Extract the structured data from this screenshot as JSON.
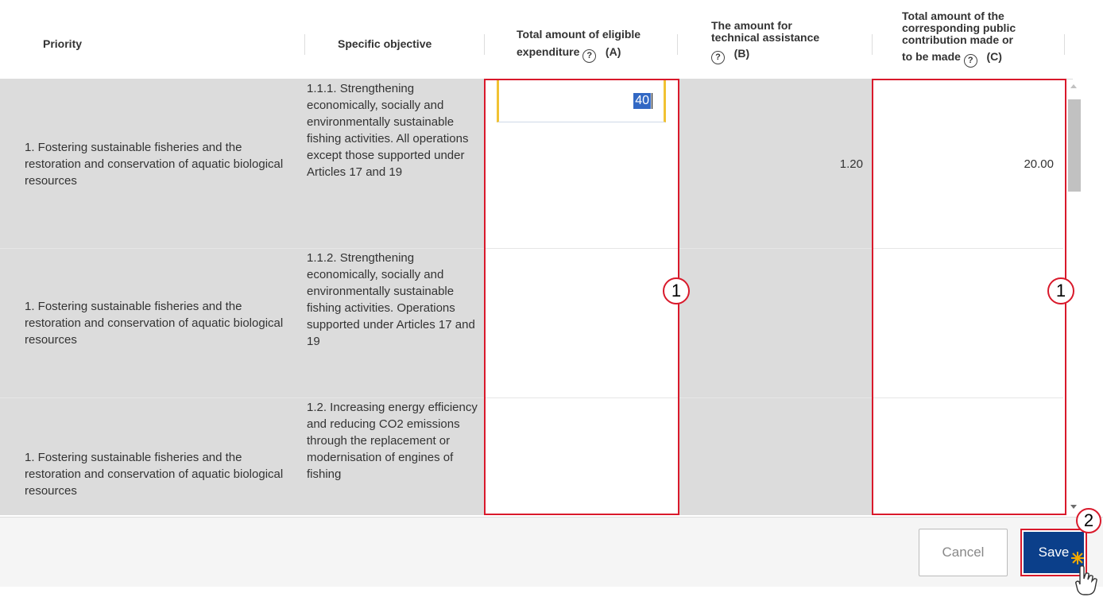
{
  "header": {
    "priority": "Priority",
    "specific_objective": "Specific objective",
    "col_a_line1": "Total amount of eligible",
    "col_a_line2": "expenditure",
    "col_a_tag": "(A)",
    "col_b_line1": "The amount for",
    "col_b_line2": "technical assistance",
    "col_b_tag": "(B)",
    "col_c_line1": "Total amount of the",
    "col_c_line2": "corresponding public",
    "col_c_line3": "contribution made or",
    "col_c_line4": "to be made",
    "col_c_tag": "(C)",
    "help_glyph": "?"
  },
  "rows": [
    {
      "priority": "1. Fostering sustainable fisheries and the restoration and conservation of aquatic biological resources",
      "objective": "1.1.1. Strengthening economically, socially and environmentally sustainable fishing activities. All operations except those supported under Articles 17 and 19",
      "eligible": "40",
      "technical": "1.20",
      "public": "20.00"
    },
    {
      "priority": "1. Fostering sustainable fisheries and the restoration and conservation of aquatic biological resources",
      "objective": "1.1.2. Strengthening economically, socially and environmentally sustainable fishing activities. Operations supported under Articles 17 and 19",
      "eligible": "",
      "technical": "",
      "public": ""
    },
    {
      "priority": "1. Fostering sustainable fisheries and the restoration and conservation of aquatic biological resources",
      "objective": "1.2. Increasing energy efficiency and reducing CO2 emissions through the replacement or modernisation of engines of fishing",
      "eligible": "",
      "technical": "",
      "public": ""
    }
  ],
  "callouts": {
    "one": "1",
    "two": "2"
  },
  "footer": {
    "cancel": "Cancel",
    "save": "Save"
  },
  "colors": {
    "highlight": "#d9192b",
    "save_bg": "#0b3f8a",
    "readonly_bg": "#dcdcdc",
    "input_border": "#f1c232"
  }
}
